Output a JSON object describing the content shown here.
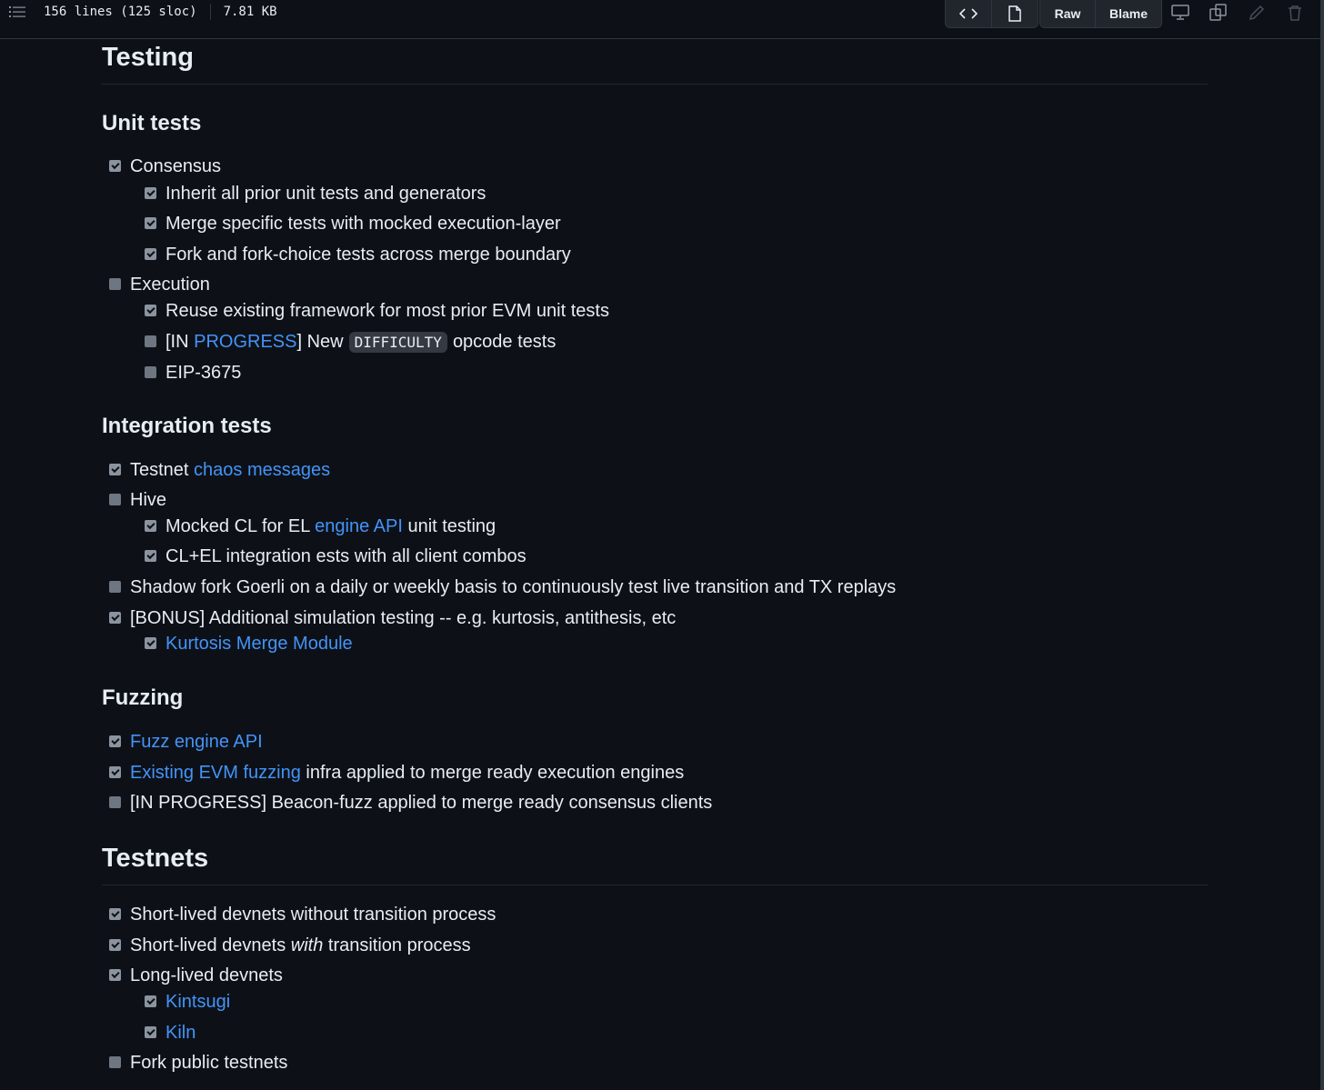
{
  "toolbar": {
    "lines": "156 lines (125 sloc)",
    "size": "7.81 KB",
    "raw_label": "Raw",
    "blame_label": "Blame",
    "icons": [
      "list-icon",
      "code-icon",
      "file-icon",
      "desktop-icon",
      "copy-icon",
      "pencil-icon",
      "trash-icon"
    ]
  },
  "testing": {
    "title": "Testing",
    "unit": {
      "title": "Unit tests",
      "consensus": {
        "label": "Consensus",
        "checked": true
      },
      "c1": "Inherit all prior unit tests and generators",
      "c2": "Merge specific tests with mocked execution-layer",
      "c3": "Fork and fork-choice tests across merge boundary",
      "execution": {
        "label": "Execution",
        "checked": false
      },
      "e1": "Reuse existing framework for most prior EVM unit tests",
      "e2_pre": "[IN ",
      "e2_link": "PROGRESS",
      "e2_mid": "] New",
      "e2_code": "DIFFICULTY",
      "e2_post": "opcode tests",
      "e3": "EIP-3675"
    },
    "integration": {
      "title": "Integration tests",
      "i1_pre": "Testnet ",
      "i1_link": "chaos messages",
      "i2": "Hive",
      "i2a_pre": "Mocked CL for EL ",
      "i2a_link": "engine API",
      "i2a_post": " unit testing",
      "i2b": "CL+EL integration ests with all client combos",
      "i3": "Shadow fork Goerli on a daily or weekly basis to continuously test live transition and TX replays",
      "i4": "[BONUS] Additional simulation testing -- e.g. kurtosis, antithesis, etc",
      "i4a_link": "Kurtosis Merge Module"
    },
    "fuzzing": {
      "title": "Fuzzing",
      "f1_link": "Fuzz engine API",
      "f2_link": "Existing EVM fuzzing",
      "f2_post": " infra applied to merge ready execution engines",
      "f3": "[IN PROGRESS] Beacon-fuzz applied to merge ready consensus clients"
    }
  },
  "testnets": {
    "title": "Testnets",
    "t1": "Short-lived devnets without transition process",
    "t2_pre": "Short-lived devnets ",
    "t2_em": "with",
    "t2_post": " transition process",
    "t3": "Long-lived devnets",
    "t3a_link": "Kintsugi",
    "t3b_link": "Kiln",
    "t4": "Fork public testnets"
  }
}
